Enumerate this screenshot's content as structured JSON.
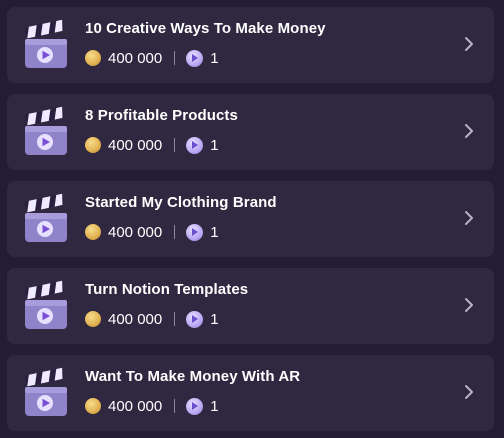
{
  "courses": [
    {
      "title": "10 Creative Ways To Make Money",
      "price": "400 000",
      "videos": "1",
      "thumb_icon": "video-clapperboard-icon",
      "chevron_icon": "chevron-right-icon"
    },
    {
      "title": "8 Profitable Products",
      "price": "400 000",
      "videos": "1",
      "thumb_icon": "video-clapperboard-icon",
      "chevron_icon": "chevron-right-icon"
    },
    {
      "title": "Started My Clothing Brand",
      "price": "400 000",
      "videos": "1",
      "thumb_icon": "video-clapperboard-icon",
      "chevron_icon": "chevron-right-icon"
    },
    {
      "title": "Turn Notion Templates",
      "price": "400 000",
      "videos": "1",
      "thumb_icon": "video-clapperboard-icon",
      "chevron_icon": "chevron-right-icon"
    },
    {
      "title": "Want To Make Money With AR",
      "price": "400 000",
      "videos": "1",
      "thumb_icon": "video-clapperboard-icon",
      "chevron_icon": "chevron-right-icon"
    }
  ],
  "colors": {
    "background": "#241c36",
    "card": "#2f2840",
    "text": "#ffffff",
    "coin": "#e3b455",
    "video_badge": "#b9a7f3",
    "chevron": "#b7b2c4"
  }
}
